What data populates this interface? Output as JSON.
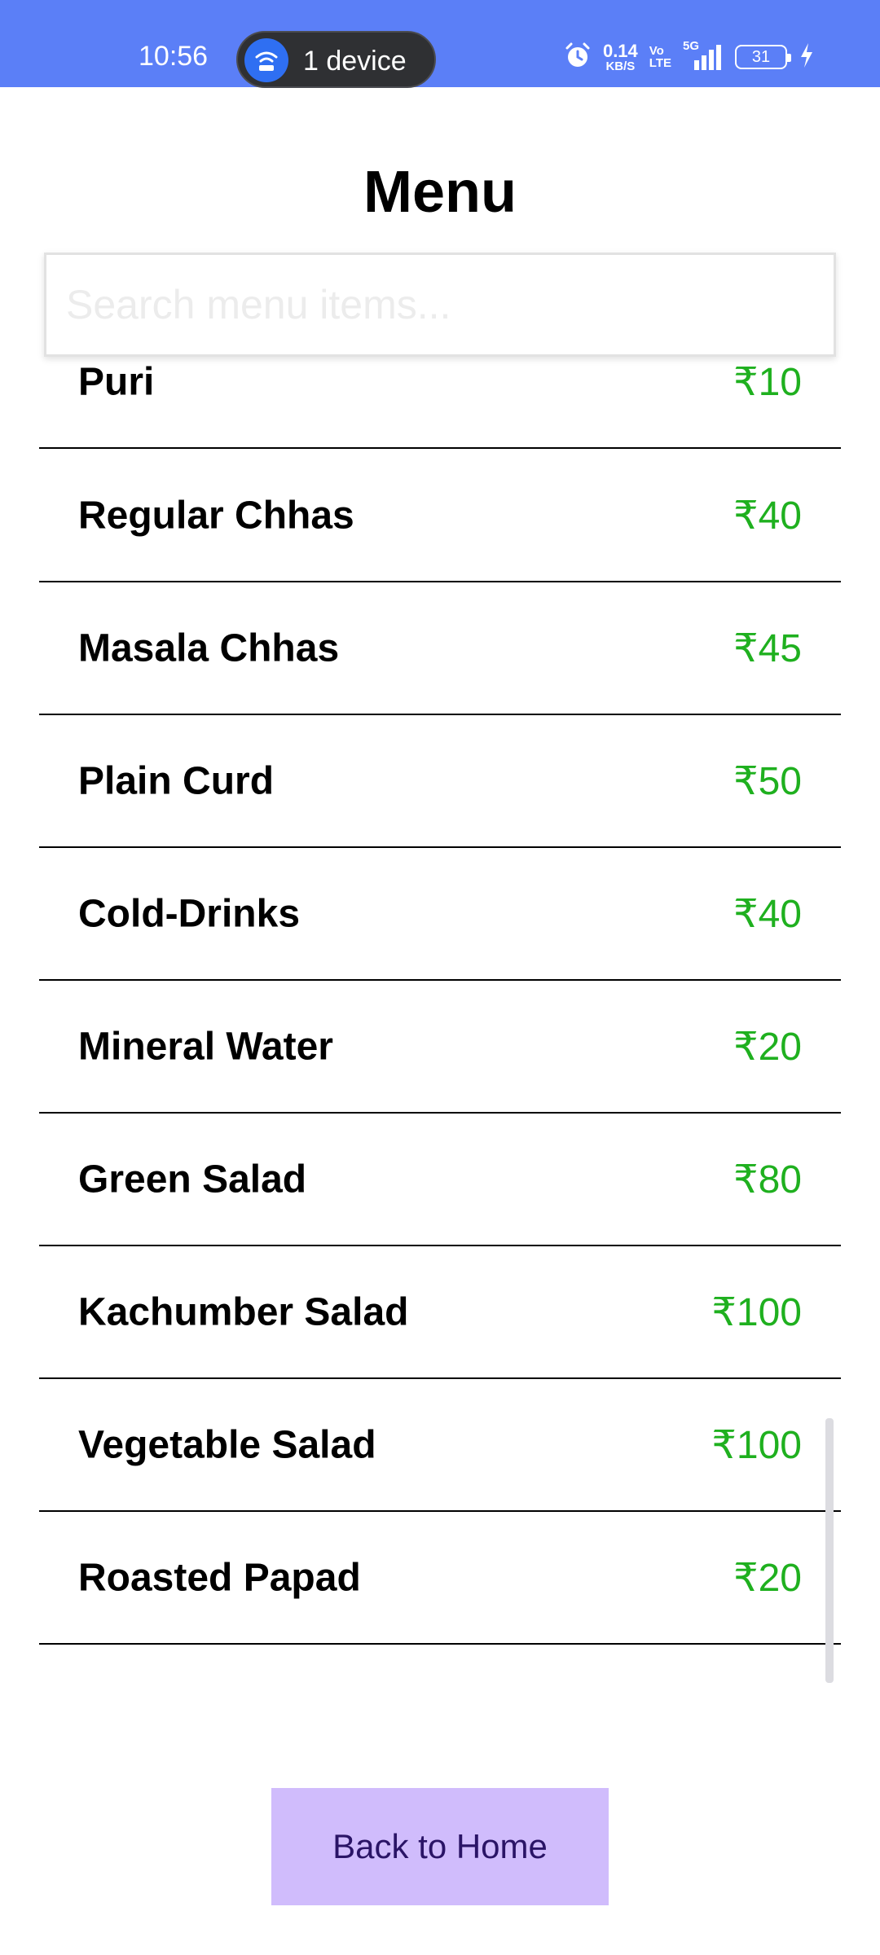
{
  "status_bar": {
    "time": "10:56",
    "hotspot_label": "1 device",
    "net_rate": "0.14",
    "net_unit": "KB/S",
    "volte_top": "Vo",
    "volte_bottom": "LTE",
    "network_type": "5G",
    "battery_level": "31",
    "colors": {
      "background": "#5B7FF7"
    }
  },
  "header": {
    "title": "Menu"
  },
  "search": {
    "placeholder": "Search menu items...",
    "value": ""
  },
  "menu": {
    "items": [
      {
        "name": "Puri",
        "price": "₹10"
      },
      {
        "name": "Regular Chhas",
        "price": "₹40"
      },
      {
        "name": "Masala Chhas",
        "price": "₹45"
      },
      {
        "name": "Plain Curd",
        "price": "₹50"
      },
      {
        "name": "Cold-Drinks",
        "price": "₹40"
      },
      {
        "name": "Mineral Water",
        "price": "₹20"
      },
      {
        "name": "Green Salad",
        "price": "₹80"
      },
      {
        "name": "Kachumber Salad",
        "price": "₹100"
      },
      {
        "name": "Vegetable Salad",
        "price": "₹100"
      },
      {
        "name": "Roasted Papad",
        "price": "₹20"
      }
    ],
    "colors": {
      "price": "#1fb01f",
      "divider": "#000000"
    }
  },
  "footer": {
    "back_label": "Back to Home",
    "colors": {
      "button_bg": "#d0bcfc",
      "button_text": "#2a1466"
    }
  }
}
